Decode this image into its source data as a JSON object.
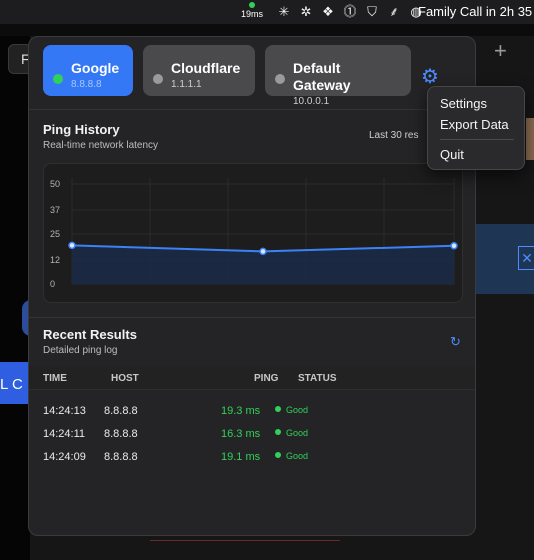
{
  "menubar": {
    "ping_status": "19ms",
    "event_text": "Family Call in 2h 35",
    "icons": [
      "burst-icon",
      "gear-badge-icon",
      "puzzle-icon",
      "one-password-icon",
      "shield-icon",
      "feather-icon",
      "waveform-icon"
    ]
  },
  "background": {
    "tab_letter": "F",
    "button_text": "L C",
    "plus": "+"
  },
  "targets": [
    {
      "name": "Google",
      "ip": "8.8.8.8",
      "active": true
    },
    {
      "name": "Cloudflare",
      "ip": "1.1.1.1",
      "active": false
    },
    {
      "name": "Default Gateway",
      "ip": "10.0.0.1",
      "active": false
    }
  ],
  "history": {
    "title": "Ping History",
    "subtitle": "Real-time network latency",
    "range_label": "Last 30 res"
  },
  "chart_data": {
    "type": "line",
    "x": [
      1,
      2,
      3
    ],
    "series": [
      {
        "values": [
          19.3,
          16.3,
          19.1
        ]
      }
    ],
    "ylim": [
      0,
      50
    ],
    "yticks": [
      0,
      12,
      25,
      37,
      50
    ],
    "grid": true,
    "legend": "none",
    "colors": {
      "line": "#3b82f6",
      "area": "#1c2a45",
      "point_fill": "#dbe7ff"
    }
  },
  "results": {
    "title": "Recent Results",
    "subtitle": "Detailed ping log",
    "columns": [
      "TIME",
      "HOST",
      "PING",
      "STATUS"
    ],
    "rows": [
      {
        "time": "14:24:13",
        "host": "8.8.8.8",
        "ping": "19.3 ms",
        "status": "Good"
      },
      {
        "time": "14:24:11",
        "host": "8.8.8.8",
        "ping": "16.3 ms",
        "status": "Good"
      },
      {
        "time": "14:24:09",
        "host": "8.8.8.8",
        "ping": "19.1 ms",
        "status": "Good"
      }
    ]
  },
  "menu": {
    "settings": "Settings",
    "export": "Export Data",
    "quit": "Quit"
  },
  "colors": {
    "accent": "#3478f6",
    "good": "#30d158"
  }
}
